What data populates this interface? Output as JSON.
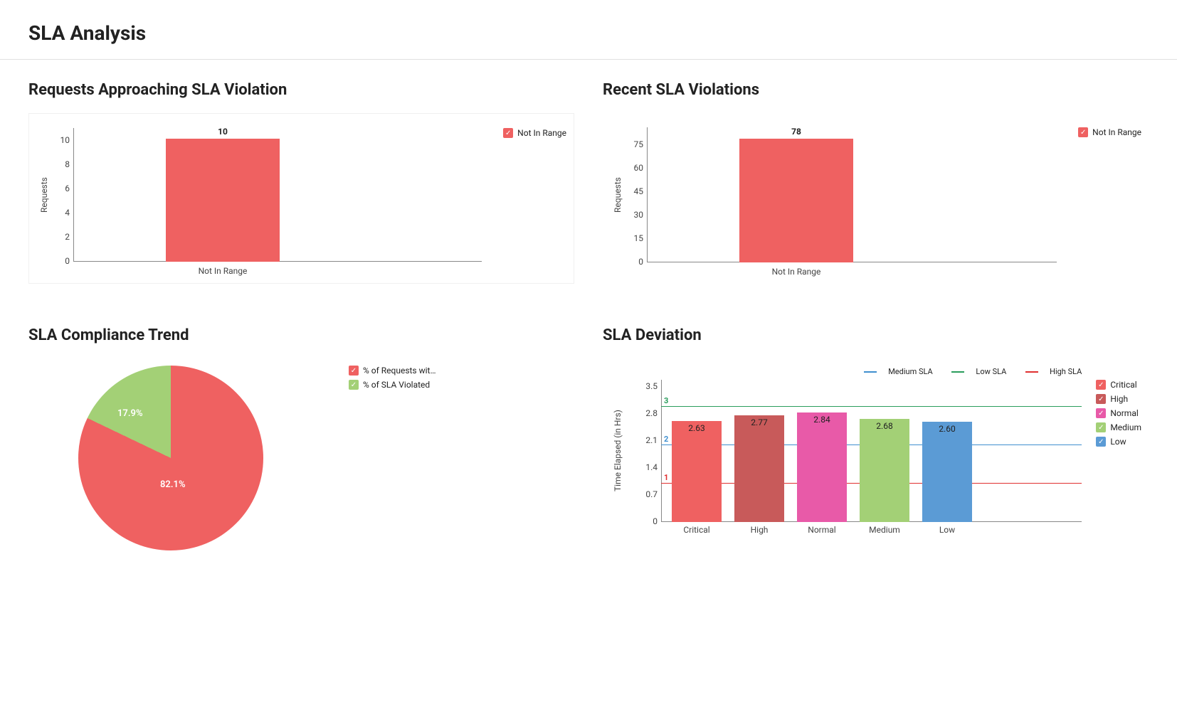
{
  "page_title": "SLA Analysis",
  "panels": {
    "approaching": {
      "title": "Requests Approaching SLA Violation",
      "ylabel": "Requests",
      "legend": "Not In Range"
    },
    "recent": {
      "title": "Recent SLA Violations",
      "ylabel": "Requests",
      "legend": "Not In Range"
    },
    "compliance": {
      "title": "SLA Compliance Trend",
      "legend1": "% of Requests wit…",
      "legend2": "% of SLA Violated"
    },
    "deviation": {
      "title": "SLA Deviation",
      "ylabel": "Time Elapsed (in Hrs)",
      "ref_medium": "Medium SLA",
      "ref_low": "Low SLA",
      "ref_high": "High SLA",
      "leg_critical": "Critical",
      "leg_high": "High",
      "leg_normal": "Normal",
      "leg_medium": "Medium",
      "leg_low": "Low"
    }
  },
  "colors": {
    "red": "#ef6161",
    "darkred": "#c85a5a",
    "pink": "#e85aa8",
    "green": "#a3d076",
    "blue": "#5b9bd5",
    "line_blue": "#3f8fcf",
    "line_green": "#2a9d5c",
    "line_red": "#e03030"
  },
  "chart_data": [
    {
      "id": "approaching",
      "type": "bar",
      "categories": [
        "Not In Range"
      ],
      "values": [
        10
      ],
      "ylabel": "Requests",
      "yticks": [
        0,
        2,
        4,
        6,
        8,
        10
      ],
      "ylim": [
        0,
        11
      ],
      "legend": [
        "Not In Range"
      ]
    },
    {
      "id": "recent",
      "type": "bar",
      "categories": [
        "Not In Range"
      ],
      "values": [
        78
      ],
      "ylabel": "Requests",
      "yticks": [
        0,
        15,
        30,
        45,
        60,
        75
      ],
      "ylim": [
        0,
        85
      ],
      "legend": [
        "Not In Range"
      ]
    },
    {
      "id": "compliance",
      "type": "pie",
      "slices": [
        {
          "label": "% of Requests within SLA",
          "value": 82.1,
          "color": "#ef6161"
        },
        {
          "label": "% of SLA Violated",
          "value": 17.9,
          "color": "#a3d076"
        }
      ]
    },
    {
      "id": "deviation",
      "type": "bar",
      "categories": [
        "Critical",
        "High",
        "Normal",
        "Medium",
        "Low"
      ],
      "series": [
        {
          "name": "Time Elapsed (in Hrs)",
          "values": [
            2.63,
            2.77,
            2.84,
            2.68,
            2.6
          ]
        }
      ],
      "bar_colors": [
        "#ef6161",
        "#c85a5a",
        "#e85aa8",
        "#a3d076",
        "#5b9bd5"
      ],
      "ylabel": "Time Elapsed (in Hrs)",
      "yticks": [
        0,
        0.7,
        1.4,
        2.1,
        2.8,
        3.5
      ],
      "ylim": [
        0,
        3.7
      ],
      "reference_lines": [
        {
          "name": "High SLA",
          "value": 1,
          "color": "#e03030"
        },
        {
          "name": "Medium SLA",
          "value": 2,
          "color": "#3f8fcf"
        },
        {
          "name": "Low SLA",
          "value": 3,
          "color": "#2a9d5c"
        }
      ],
      "legend": [
        "Critical",
        "High",
        "Normal",
        "Medium",
        "Low"
      ]
    }
  ],
  "labels": {
    "approaching_val": "10",
    "approaching_cat": "Not In Range",
    "recent_val": "78",
    "recent_cat": "Not In Range",
    "pie_big": "82.1%",
    "pie_small": "17.9%",
    "dev_c0": "Critical",
    "dev_c1": "High",
    "dev_c2": "Normal",
    "dev_c3": "Medium",
    "dev_c4": "Low",
    "dev_v0": "2.63",
    "dev_v1": "2.77",
    "dev_v2": "2.84",
    "dev_v3": "2.68",
    "dev_v4": "2.60",
    "ref1": "1",
    "ref2": "2",
    "ref3": "3",
    "yt_a0": "0",
    "yt_a1": "2",
    "yt_a2": "4",
    "yt_a3": "6",
    "yt_a4": "8",
    "yt_a5": "10",
    "yt_r0": "0",
    "yt_r1": "15",
    "yt_r2": "30",
    "yt_r3": "45",
    "yt_r4": "60",
    "yt_r5": "75",
    "yt_d0": "0",
    "yt_d1": "0.7",
    "yt_d2": "1.4",
    "yt_d3": "2.1",
    "yt_d4": "2.8",
    "yt_d5": "3.5"
  }
}
